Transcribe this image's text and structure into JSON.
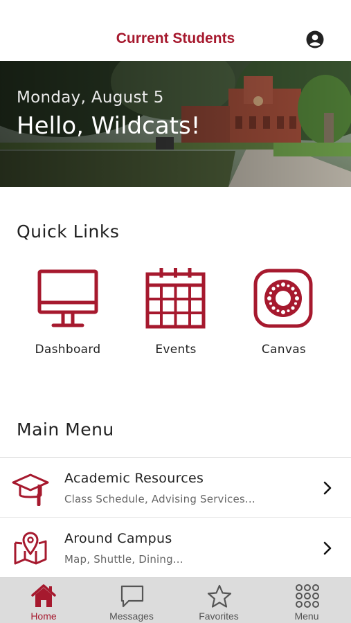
{
  "header": {
    "title": "Current Students",
    "profile_icon": "profile-icon"
  },
  "hero": {
    "date": "Monday, August 5",
    "greeting": "Hello, Wildcats!"
  },
  "quick_links": {
    "title": "Quick Links",
    "items": [
      {
        "label": "Dashboard",
        "icon": "monitor-icon"
      },
      {
        "label": "Events",
        "icon": "calendar-icon"
      },
      {
        "label": "Canvas",
        "icon": "canvas-icon"
      }
    ]
  },
  "main_menu": {
    "title": "Main Menu",
    "items": [
      {
        "title": "Academic Resources",
        "subtitle": "Class Schedule, Advising Services...",
        "icon": "graduation-cap-icon"
      },
      {
        "title": "Around Campus",
        "subtitle": "Map, Shuttle, Dining...",
        "icon": "map-icon"
      }
    ]
  },
  "tabbar": {
    "items": [
      {
        "label": "Home",
        "icon": "home-icon",
        "active": true
      },
      {
        "label": "Messages",
        "icon": "chat-icon"
      },
      {
        "label": "Favorites",
        "icon": "star-icon"
      },
      {
        "label": "Menu",
        "icon": "grid-icon"
      }
    ]
  },
  "colors": {
    "brand": "#a6192e",
    "tabbar_bg": "#dcdcdc",
    "text": "#222222",
    "subtext": "#666666"
  }
}
